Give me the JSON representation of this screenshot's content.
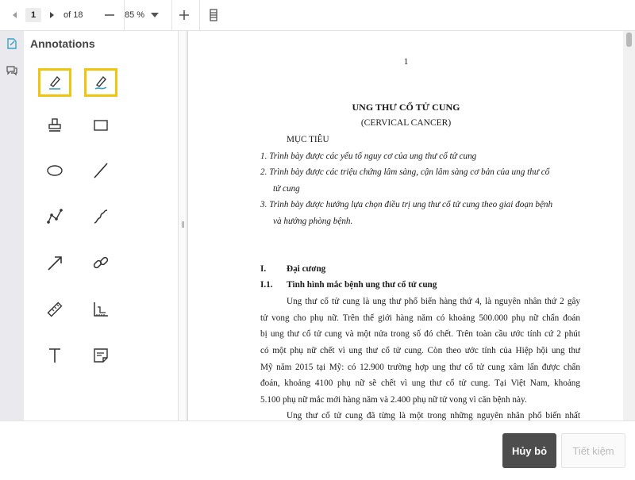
{
  "toolbar": {
    "page_current": "1",
    "page_total": "of 18",
    "zoom": "85 %",
    "icons": [
      "prev-page-icon",
      "next-page-icon",
      "zoom-out-icon",
      "zoom-dropdown-icon",
      "zoom-in-icon",
      "fit-page-icon"
    ]
  },
  "rail": {
    "icons": [
      "annotation-pen-icon",
      "comments-icon"
    ]
  },
  "panel": {
    "title": "Annotations",
    "tools": [
      "highlight-icon",
      "freehand-highlight-icon",
      "stamp-icon",
      "rectangle-icon",
      "ellipse-icon",
      "line-icon",
      "polyline-icon",
      "freehand-icon",
      "arrow-icon",
      "link-icon",
      "ruler-icon",
      "area-measure-icon",
      "text-icon",
      "sticky-note-icon"
    ]
  },
  "document": {
    "page_number": "1",
    "title": "UNG THƯ CỔ TỬ CUNG",
    "subtitle": "(CERVICAL CANCER)",
    "objectives_heading": "MỤC TIÊU",
    "objectives": [
      "1.  Trình bày được các yếu tố nguy cơ của ung thư cổ tử cung",
      "2.  Trình bày được các triệu chứng lâm sàng, cận lâm sàng cơ bản của ung thư cổ",
      "tử cung",
      "3.  Trình bày được hướng lựa chọn điều trị ung thư cổ tử cung theo giai đoạn bệnh",
      "và hướng phòng bệnh."
    ],
    "section_1": "Đại cương",
    "section_1_num": "I.",
    "section_1_1_num": "I.1.",
    "section_1_1": "Tình hình mắc bệnh ung thư cổ tử cung",
    "paragraph_1": [
      "Ung thư cổ tử cung là ung thư phổ biến hàng thứ 4, là nguyên nhân thứ 2 gây",
      "tử vong cho phụ nữ. Trên thế giới hàng năm có khoảng 500.000 phụ nữ chẩn đoán",
      "bị ung thư cổ tử cung và một nửa trong số đó chết. Trên toàn cầu ước tính cứ 2 phút",
      "có một phụ nữ chết vì ung thư cổ tử cung. Còn theo ước tính của Hiệp hội ung thư",
      "Mỹ năm 2015 tại Mỹ: có 12.900 trường hợp ung thư cổ tử cung xâm lấn được chẩn",
      "đoán, khoảng 4100 phụ nữ sẽ chết vì ung thư cổ tử cung. Tại Việt Nam, khoảng",
      "5.100 phụ nữ mắc mới hàng năm và 2.400 phụ nữ tử vong vì căn bệnh này."
    ],
    "paragraph_2_start": "Ung thư cổ tử cung đã từng là một trong những nguyên nhân phổ biến nhất"
  },
  "footer": {
    "cancel_label": "Hủy bỏ",
    "save_label": "Tiết kiệm"
  },
  "colors": {
    "selection_border": "#f1c40f",
    "cancel_bg": "#4d4d4d",
    "accent_icon": "#3aa0c8"
  }
}
